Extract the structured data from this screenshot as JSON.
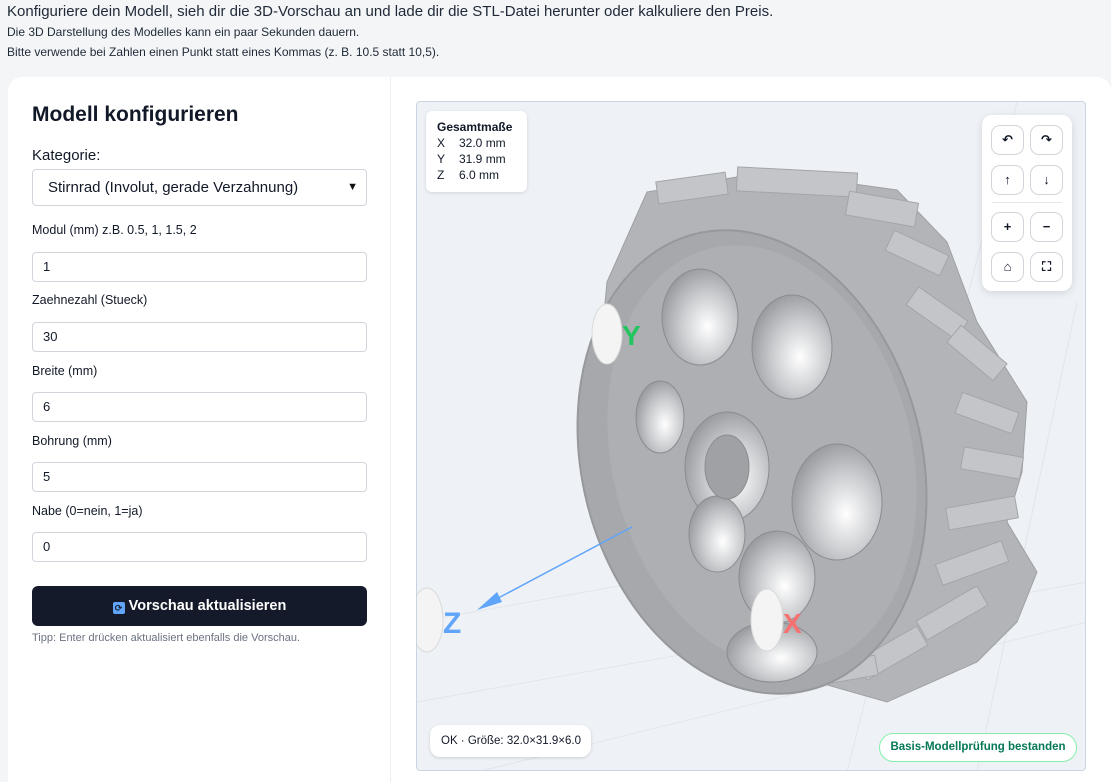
{
  "intro": {
    "headline": "Konfiguriere dein Modell, sieh dir die 3D-Vorschau an und lade dir die STL-Datei herunter oder kalkuliere den Preis.",
    "line1": "Die 3D Darstellung des Modelles kann ein paar Sekunden dauern.",
    "line2": "Bitte verwende bei Zahlen einen Punkt statt eines Kommas (z. B. 10.5 statt 10,5)."
  },
  "config": {
    "title": "Modell konfigurieren",
    "category_label": "Kategorie:",
    "category_value": "Stirnrad (Involut, gerade Verzahnung)",
    "fields": [
      {
        "label": "Modul (mm) z.B. 0.5, 1, 1.5, 2",
        "value": "1"
      },
      {
        "label": "Zaehnezahl (Stueck)",
        "value": "30"
      },
      {
        "label": "Breite (mm)",
        "value": "6"
      },
      {
        "label": "Bohrung (mm)",
        "value": "5"
      },
      {
        "label": "Nabe (0=nein, 1=ja)",
        "value": "0"
      }
    ],
    "update_button": "Vorschau aktualisieren",
    "tip": "Tipp: Enter drücken aktualisiert ebenfalls die Vorschau."
  },
  "viewer": {
    "dims": {
      "title": "Gesamtmaße",
      "x_label": "X",
      "x_value": "32.0 mm",
      "y_label": "Y",
      "y_value": "31.9 mm",
      "z_label": "Z",
      "z_value": "6.0 mm"
    },
    "axes": {
      "x": "X",
      "y": "Y",
      "z": "Z"
    },
    "controls": {
      "rotate_left": "↶",
      "rotate_right": "↷",
      "up": "↑",
      "down": "↓",
      "zoom_in": "+",
      "zoom_out": "−",
      "home": "⌂",
      "fullscreen": "⛶"
    },
    "status": "OK · Größe: 32.0×31.9×6.0",
    "check_badge": "Basis-Modellprüfung bestanden",
    "colors": {
      "gear": "#a9abae",
      "axis_x": "#ef4444",
      "axis_y": "#22c55e",
      "axis_z": "#60a5fa"
    }
  }
}
